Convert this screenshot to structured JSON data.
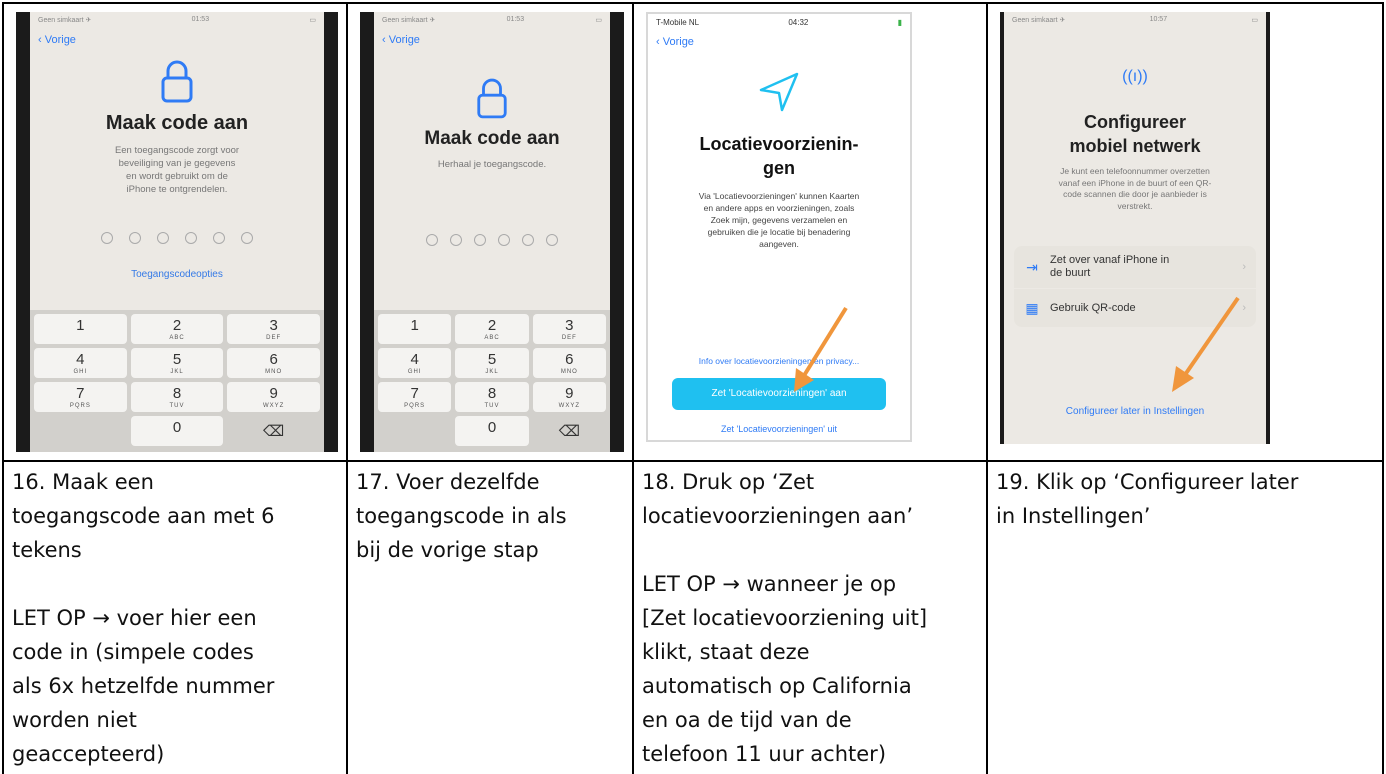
{
  "panels": [
    {
      "status_left": "Geen simkaart ✈",
      "status_time": "01:53",
      "back": "Vorige",
      "title": "Maak code aan",
      "subtitle": "Een toegangscode zorgt voor\nbeveiliging van je gegevens\nen wordt gebruikt om de\niPhone te ontgrendelen.",
      "link": "Toegangscodeopties"
    },
    {
      "status_left": "Geen simkaart ✈",
      "status_time": "01:53",
      "back": "Vorige",
      "title": "Maak code aan",
      "subtitle": "Herhaal je toegangscode."
    },
    {
      "status_left": "T-Mobile NL",
      "status_time": "04:32",
      "back": "Vorige",
      "title": "Locatievoorzienin-\ngen",
      "subtitle": "Via 'Locatievoorzieningen' kunnen Kaarten\nen andere apps en voorzieningen, zoals\nZoek mijn, gegevens verzamelen en\ngebruiken die je locatie bij benadering\naangeven.",
      "link": "Info over locatievoorzieningen en privacy...",
      "button_on": "Zet 'Locatievoorzieningen' aan",
      "button_off": "Zet 'Locatievoorzieningen' uit"
    },
    {
      "status_left": "Geen simkaart ✈",
      "status_time": "10:57",
      "title": "Configureer\nmobiel netwerk",
      "subtitle": "Je kunt een telefoonnummer overzetten\nvanaf een iPhone in de buurt of een QR-\ncode scannen die door je aanbieder is\nverstrekt.",
      "option1": "Zet over vanaf iPhone in\nde buurt",
      "option2": "Gebruik QR-code",
      "link": "Configureer later in Instellingen"
    }
  ],
  "keypad": [
    {
      "d": "1",
      "l": ""
    },
    {
      "d": "2",
      "l": "ABC"
    },
    {
      "d": "3",
      "l": "DEF"
    },
    {
      "d": "4",
      "l": "GHI"
    },
    {
      "d": "5",
      "l": "JKL"
    },
    {
      "d": "6",
      "l": "MNO"
    },
    {
      "d": "7",
      "l": "PQRS"
    },
    {
      "d": "8",
      "l": "TUV"
    },
    {
      "d": "9",
      "l": "WXYZ"
    },
    {
      "d": "0",
      "l": ""
    }
  ],
  "captions": [
    {
      "main": "16. Maak een\ntoegangscode aan met 6\ntekens",
      "note": "LET OP → voer hier een\ncode in (simpele codes\nals 6x hetzelfde nummer\nworden niet\ngeaccepteerd)"
    },
    {
      "main": "17. Voer dezelfde\ntoegangscode in als\nbij de vorige stap"
    },
    {
      "main": "18. Druk op ‘Zet\nlocatievoorzieningen aan’",
      "note": "LET OP → wanneer je op\n[Zet locatievoorziening uit]\nklikt, staat deze\nautomatisch op California\nen oa de tijd van de\ntelefoon 11 uur achter)"
    },
    {
      "main": "19. Klik op ‘Configureer later\nin Instellingen’"
    }
  ],
  "colors": {
    "accent_blue": "#2f7bf5",
    "button_cyan": "#1fc0f0",
    "arrow_orange": "#f0963c"
  }
}
